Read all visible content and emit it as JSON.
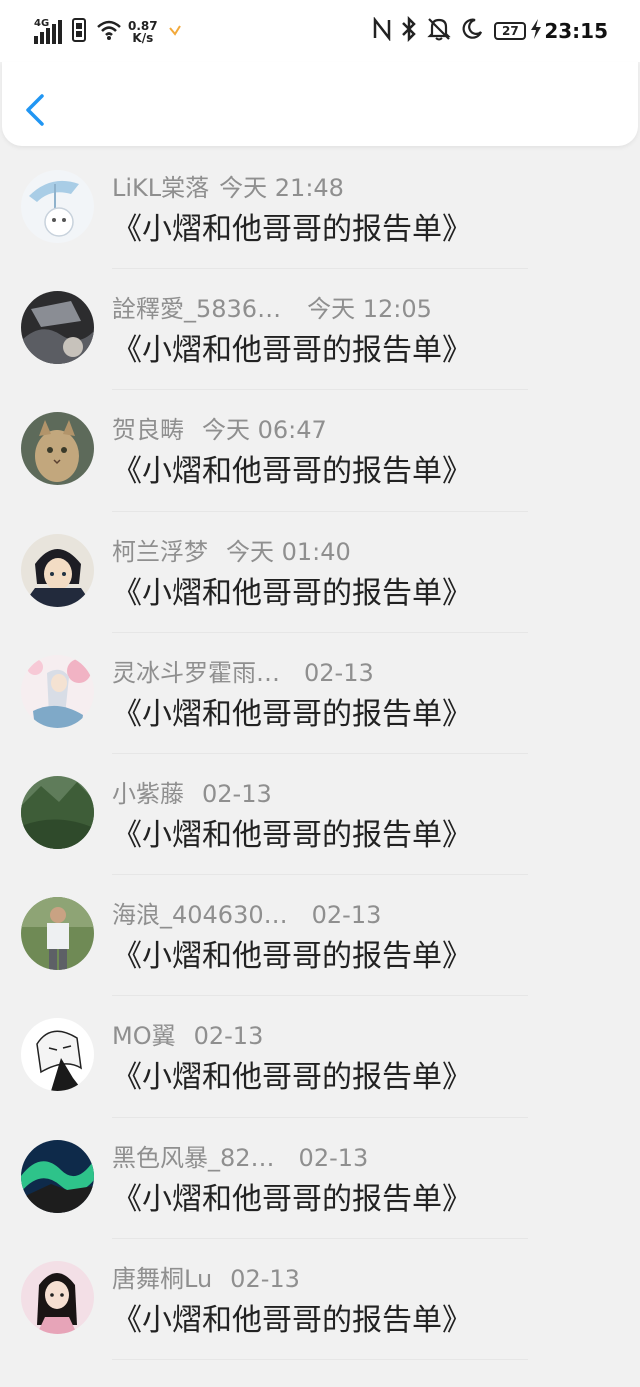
{
  "status_bar": {
    "network": "4G",
    "speed_value": "0.87",
    "speed_unit": "K/s",
    "battery": "27",
    "time": "23:15"
  },
  "header": {
    "back_icon": "chevron-left-icon",
    "accent": "#2196f3"
  },
  "items": [
    {
      "name": "LiKL棠落",
      "time": "今天 21:48",
      "title": "《小熠和他哥哥的报告单》"
    },
    {
      "name": "詮釋愛_5836…",
      "time": "今天 12:05",
      "title": "《小熠和他哥哥的报告单》"
    },
    {
      "name": "贺良畴",
      "time": "今天 06:47",
      "title": "《小熠和他哥哥的报告单》"
    },
    {
      "name": "柯兰浮梦",
      "time": "今天 01:40",
      "title": "《小熠和他哥哥的报告单》"
    },
    {
      "name": "灵冰斗罗霍雨…",
      "time": "02-13",
      "title": "《小熠和他哥哥的报告单》"
    },
    {
      "name": "小紫藤",
      "time": "02-13",
      "title": "《小熠和他哥哥的报告单》"
    },
    {
      "name": "海浪_404630…",
      "time": "02-13",
      "title": "《小熠和他哥哥的报告单》"
    },
    {
      "name": "MO翼",
      "time": "02-13",
      "title": "《小熠和他哥哥的报告单》"
    },
    {
      "name": "黑色风暴_82…",
      "time": "02-13",
      "title": "《小熠和他哥哥的报告单》"
    },
    {
      "name": "唐舞桐Lu",
      "time": "02-13",
      "title": "《小熠和他哥哥的报告单》"
    }
  ]
}
